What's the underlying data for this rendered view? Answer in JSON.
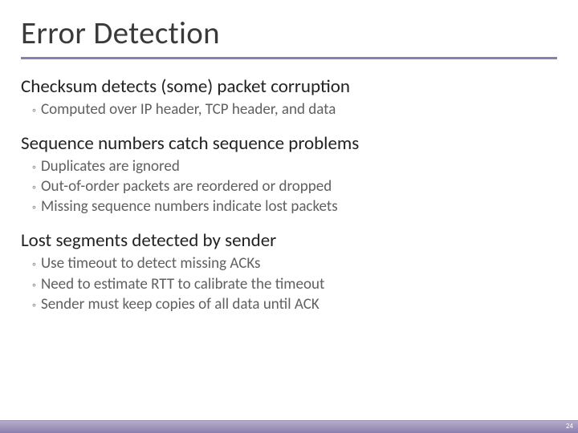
{
  "title": "Error Detection",
  "sections": [
    {
      "head": "Checksum detects (some) packet corruption",
      "bullets": [
        "Computed over IP header, TCP header, and data"
      ]
    },
    {
      "head": "Sequence numbers catch sequence problems",
      "bullets": [
        "Duplicates are ignored",
        "Out-of-order packets are reordered or dropped",
        "Missing sequence numbers indicate lost packets"
      ]
    },
    {
      "head": "Lost segments detected by sender",
      "bullets": [
        "Use timeout to detect missing ACKs",
        "Need to estimate RTT to calibrate the timeout",
        "Sender must keep copies of all data until ACK"
      ]
    }
  ],
  "page_number": "24"
}
